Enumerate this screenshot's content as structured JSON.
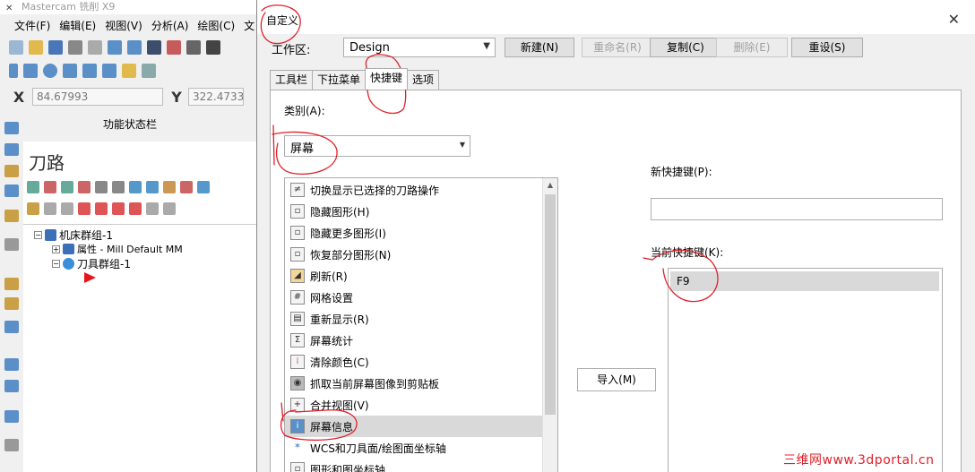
{
  "app": {
    "title": "Mastercam 铣削 X9"
  },
  "menu": [
    "文件(F)",
    "编辑(E)",
    "视图(V)",
    "分析(A)",
    "绘图(C)",
    "文"
  ],
  "coords": {
    "x_label": "X",
    "x_value": "84.67993",
    "y_label": "Y",
    "y_value": "322.4733"
  },
  "status_bar_label": "功能状态栏",
  "toolpath_panel": {
    "title": "刀路",
    "tree": {
      "machine_group": "机床群组-1",
      "properties": "属性 - Mill Default MM",
      "toolpath_group": "刀具群组-1"
    }
  },
  "dialog": {
    "title": "自定义",
    "workspace_label": "工作区:",
    "workspace_value": "Design",
    "buttons": {
      "new": "新建(N)",
      "rename": "重命名(R)",
      "copy": "复制(C)",
      "delete": "删除(E)",
      "reset": "重设(S)"
    },
    "tabs": [
      "工具栏",
      "下拉菜单",
      "快捷键",
      "选项"
    ],
    "active_tab": "快捷键",
    "category_label": "类别(A):",
    "category_value": "屏幕",
    "commands": [
      "切换显示已选择的刀路操作",
      "隐藏图形(H)",
      "隐藏更多图形(I)",
      "恢复部分图形(N)",
      "刷新(R)",
      "网格设置",
      "重新显示(R)",
      "屏幕统计",
      "清除颜色(C)",
      "抓取当前屏幕图像到剪贴板",
      "合并视图(V)",
      "屏幕信息",
      "WCS和刀具面/绘图面坐标轴",
      "图形和图坐标轴"
    ],
    "selected_command": "屏幕信息",
    "import_button": "导入(M)",
    "new_shortcut_label": "新快捷键(P):",
    "new_shortcut_value": "",
    "current_shortcut_label": "当前快捷键(K):",
    "current_shortcuts": [
      "F9"
    ]
  },
  "watermark": "三维网www.3dportal.cn",
  "colors": {
    "annotation": "#e0202a",
    "selection": "#d9d9d9"
  }
}
